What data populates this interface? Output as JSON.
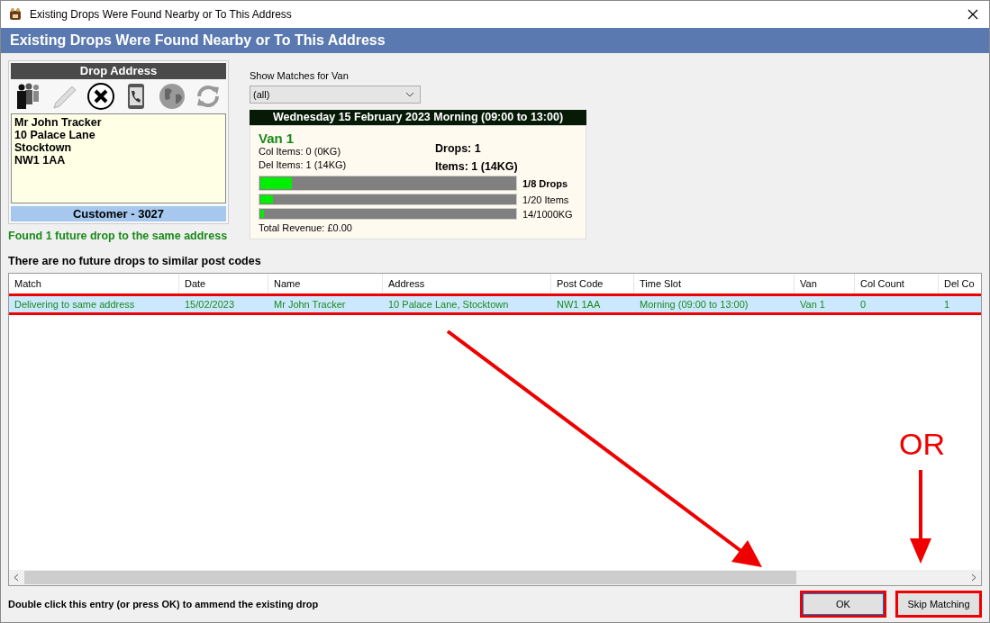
{
  "window": {
    "title": "Existing Drops Were Found Nearby or To This Address"
  },
  "header": "Existing Drops Were Found Nearby or To This Address",
  "drop_address": {
    "title": "Drop Address",
    "lines": [
      "Mr John Tracker",
      "10 Palace Lane",
      "Stocktown",
      "NW1 1AA"
    ],
    "customer": "Customer - 3027",
    "tools": [
      {
        "kind": "people",
        "disabled": false
      },
      {
        "kind": "pencil",
        "disabled": true
      },
      {
        "kind": "cancel",
        "disabled": false
      },
      {
        "kind": "phone",
        "disabled": false
      },
      {
        "kind": "globe",
        "disabled": true
      },
      {
        "kind": "refresh",
        "disabled": true
      }
    ]
  },
  "found_message": "Found 1 future drop to the same address",
  "van_filter": {
    "label": "Show Matches for Van",
    "value": "(all)"
  },
  "slot": {
    "title": "Wednesday 15 February 2023 Morning (09:00 to 13:00)",
    "van": "Van 1",
    "col_items": "Col Items: 0 (0KG)",
    "del_items": "Del Items: 1 (14KG)",
    "drops": "Drops: 1",
    "items": "Items: 1 (14KG)",
    "meters": [
      {
        "level": 0.125,
        "reading": "1/8 Drops",
        "bold": true
      },
      {
        "level": 0.05,
        "reading": "1/20 Items",
        "bold": false
      },
      {
        "level": 0.014,
        "reading": "14/1000KG",
        "bold": false
      }
    ],
    "revenue": "Total Revenue: £0.00"
  },
  "postcode_message": "There are no future drops to similar post codes",
  "table": {
    "columns": [
      "Match",
      "Date",
      "Name",
      "Address",
      "Post Code",
      "Time Slot",
      "Van",
      "Col Count",
      "Del Co"
    ],
    "rows": [
      {
        "cells": [
          "Delivering to same address",
          "15/02/2023",
          "Mr John Tracker",
          "10 Palace Lane, Stocktown",
          "NW1 1AA",
          "Morning (09:00 to 13:00)",
          "Van 1",
          "0",
          "1"
        ],
        "selected": true,
        "highlighted": true
      }
    ]
  },
  "hint": "Double click this entry (or press OK) to ammend the existing drop",
  "buttons": [
    {
      "label": "OK",
      "highlighted": true,
      "default": true
    },
    {
      "label": "Skip Matching",
      "highlighted": true,
      "default": false
    }
  ],
  "annotation": {
    "text": "OR"
  }
}
